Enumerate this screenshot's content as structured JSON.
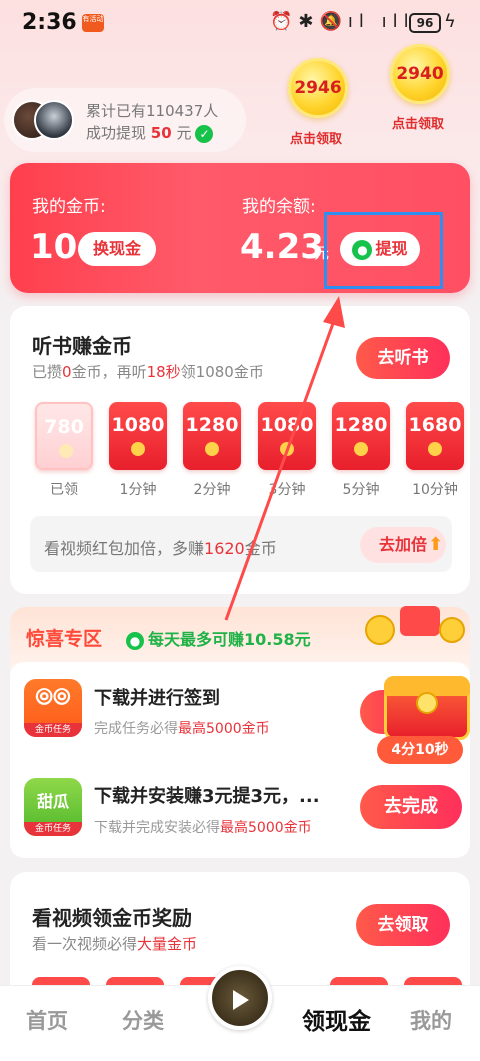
{
  "status_bar": {
    "time": "2:36",
    "app_badge": "有活动",
    "battery": "96"
  },
  "banner": {
    "line1": "累计已有110437人",
    "line2_prefix": "成功提现",
    "line2_amount": "50",
    "line2_suffix": "元"
  },
  "coins": [
    {
      "amount": "2946",
      "label": "点击领取"
    },
    {
      "amount": "2940",
      "label": "点击领取"
    }
  ],
  "wallet": {
    "coins_label": "我的金币:",
    "coins_value": "10",
    "exchange_label": "换现金",
    "balance_label": "我的余额:",
    "balance_value": "4.23",
    "balance_unit": "元",
    "withdraw_label": "提现"
  },
  "listen": {
    "title": "听书赚金币",
    "sub_p1": "已攒",
    "sub_p2": "0",
    "sub_p3": "金币，再听",
    "sub_p4": "18秒",
    "sub_p5": "领1080金币",
    "button": "去听书",
    "envelopes": [
      {
        "value": "780",
        "label": "已领",
        "claimed": true
      },
      {
        "value": "1080",
        "label": "1分钟"
      },
      {
        "value": "1280",
        "label": "2分钟"
      },
      {
        "value": "1080",
        "label": "3分钟"
      },
      {
        "value": "1280",
        "label": "5分钟"
      },
      {
        "value": "1680",
        "label": "10分钟"
      }
    ],
    "double_p1": "看视频红包加倍，多赚",
    "double_p2": "1620",
    "double_p3": "金币",
    "double_button": "去加倍"
  },
  "surprise": {
    "title": "惊喜专区",
    "subtitle": "每天最多可赚10.58元",
    "task_band": "金币任务",
    "icon2_glyph": "甜瓜",
    "task1_title": "下载并进行签到",
    "task1_sub_p1": "完成任务必得",
    "task1_sub_p2": "最高5000金币",
    "task2_title": "下载并安装赚3元提3元，...",
    "task2_sub_p1": "下载并完成安装必得",
    "task2_sub_p2": "最高5000金币",
    "task2_button": "去完成",
    "timer": "4分10秒"
  },
  "video": {
    "title": "看视频领金币奖励",
    "sub_p1": "看一次视频必得",
    "sub_p2": "大量金币",
    "button": "去领取"
  },
  "nav": {
    "home": "首页",
    "category": "分类",
    "cash": "领现金",
    "mine": "我的"
  },
  "colors": {
    "accent": "#e8333a",
    "highlight_box": "#2d8ff0",
    "wechat": "#17c24a"
  }
}
